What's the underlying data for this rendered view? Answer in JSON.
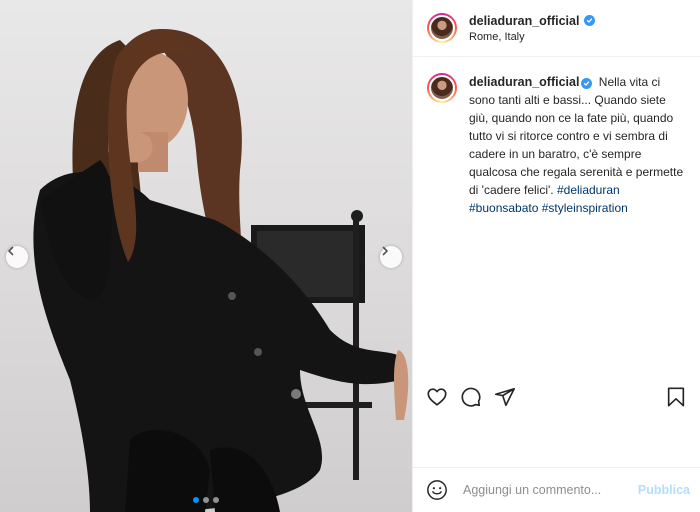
{
  "post": {
    "username": "deliaduran_official",
    "location": "Rome, Italy",
    "caption": {
      "username": "deliaduran_official",
      "text": "Nella vita ci sono tanti alti e bassi... Quando siete giù, quando non ce la fate più, quando tutto vi si ritorce contro e vi sembra di cadere in un baratro, c'è sempre qualcosa che regala serenità e permette di 'cadere felici'.",
      "hashtags": [
        "#deliaduran",
        "#buonsabato",
        "#styleinspiration"
      ]
    },
    "carousel": {
      "total": 3,
      "current": 1
    }
  },
  "actions": [
    "heart-icon",
    "comment-icon",
    "share-icon",
    "bookmark-icon"
  ],
  "comment": {
    "placeholder": "Aggiungi un commento...",
    "publish_label": "Pubblica"
  },
  "colors": {
    "verified": "#3897f0",
    "hashtag": "#00376b",
    "publish_disabled": "#b2dffc",
    "dot_active": "#0095f6"
  }
}
